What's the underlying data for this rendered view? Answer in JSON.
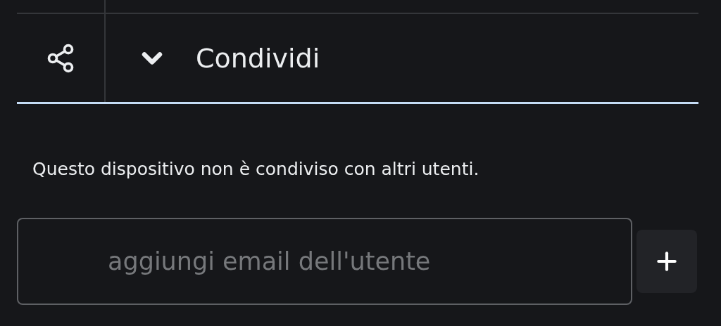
{
  "section": {
    "title": "Condividi",
    "expanded": true
  },
  "message": "Questo dispositivo non è condiviso con altri utenti.",
  "email_field": {
    "placeholder": "aggiungi email dell'utente"
  }
}
